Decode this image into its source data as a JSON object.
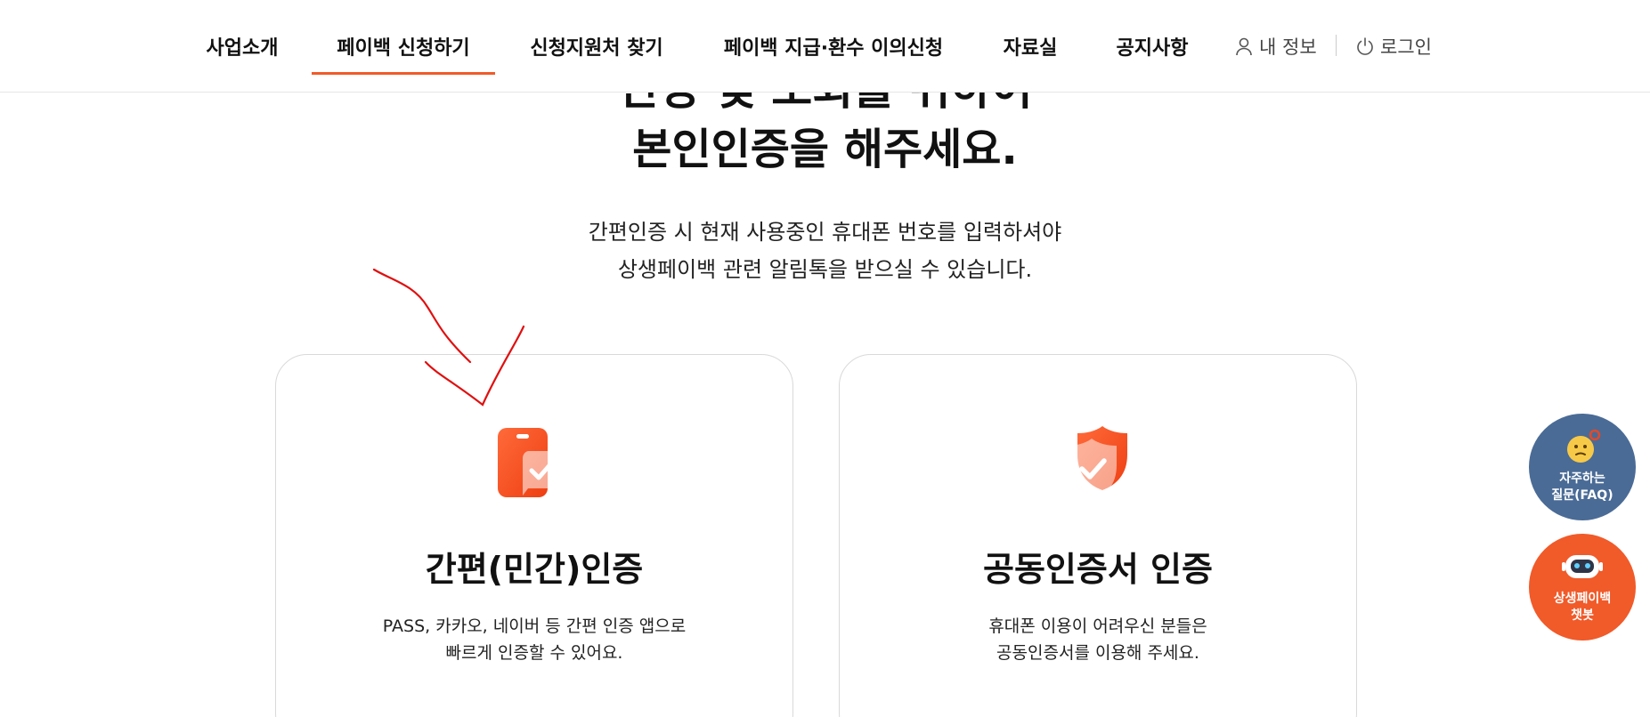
{
  "nav": {
    "items": [
      {
        "label": "사업소개"
      },
      {
        "label": "페이백 신청하기"
      },
      {
        "label": "신청지원처 찾기"
      },
      {
        "label": "페이백 지급·환수 이의신청"
      },
      {
        "label": "자료실"
      },
      {
        "label": "공지사항"
      }
    ],
    "my_info": "내 정보",
    "login": "로그인"
  },
  "hero": {
    "partial_line": "신청 및 조회를 위하여",
    "title": "본인인증을 해주세요.",
    "desc_line1": "간편인증 시 현재 사용중인 휴대폰 번호를 입력하셔야",
    "desc_line2": "상생페이백 관련 알림톡을 받으실 수 있습니다."
  },
  "cards": [
    {
      "title": "간편(민간)인증",
      "desc_line1": "PASS, 카카오, 네이버 등 간편 인증 앱으로",
      "desc_line2": "빠르게 인증할 수 있어요."
    },
    {
      "title": "공동인증서 인증",
      "desc_line1": "휴대폰 이용이 어려우신 분들은",
      "desc_line2": "공동인증서를 이용해 주세요."
    }
  ],
  "floating": {
    "faq_line1": "자주하는",
    "faq_line2": "질문(FAQ)",
    "bot_line1": "상생페이백",
    "bot_line2": "챗봇"
  },
  "colors": {
    "accent": "#f15a29",
    "faq_bg": "#4a6b96",
    "annotation": "#e01010"
  }
}
